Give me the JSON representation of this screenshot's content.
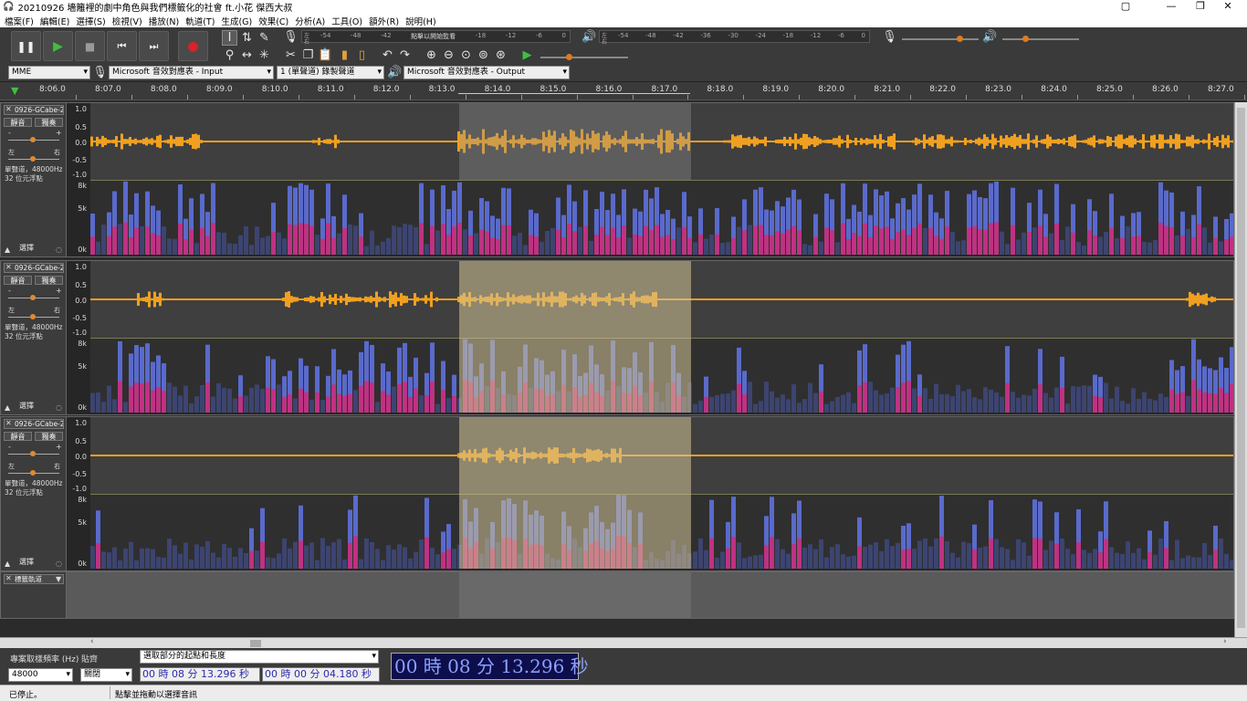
{
  "window": {
    "title": "20210926 墻籬裡的劇中角色與我們標籤化的社會 ft.小花 傑西大叔",
    "controls": [
      "▢",
      "—",
      "❐",
      "✕"
    ]
  },
  "menu": [
    "檔案(F)",
    "編輯(E)",
    "選擇(S)",
    "檢視(V)",
    "播放(N)",
    "軌道(T)",
    "生成(G)",
    "效果(C)",
    "分析(A)",
    "工具(O)",
    "額外(R)",
    "說明(H)"
  ],
  "transport": {
    "pause": "❚❚",
    "play": "▶",
    "stop": "■",
    "skip_start": "⏮",
    "skip_end": "⏭",
    "record": "●"
  },
  "meters": {
    "record_ticks": [
      "-54",
      "-48",
      "-42",
      "點擊以開始監看",
      "-18",
      "-12",
      "-6",
      "0"
    ],
    "play_ticks": [
      "-54",
      "-48",
      "-42",
      "-36",
      "-30",
      "-24",
      "-18",
      "-12",
      "-6",
      "0"
    ],
    "lr": [
      "左",
      "右"
    ]
  },
  "device_bar": {
    "host": "MME",
    "input": "Microsoft 音效對應表 - Input",
    "channels": "1 (單聲道) 錄製聲道",
    "output": "Microsoft 音效對應表 - Output"
  },
  "ruler": {
    "ticks": [
      "8:06.0",
      "8:07.0",
      "8:08.0",
      "8:09.0",
      "8:10.0",
      "8:11.0",
      "8:12.0",
      "8:13.0",
      "8:14.0",
      "8:15.0",
      "8:16.0",
      "8:17.0",
      "8:18.0",
      "8:19.0",
      "8:20.0",
      "8:21.0",
      "8:22.0",
      "8:23.0",
      "8:24.0",
      "8:25.0",
      "8:26.0",
      "8:27.0"
    ]
  },
  "tracks": [
    {
      "name": "0926-GCabe-2",
      "mute": "靜音",
      "solo": "獨奏",
      "info1": "單聲道，48000Hz",
      "info2": "32 位元浮點",
      "select": "選擇",
      "left": "左",
      "right": "右",
      "minus": "-",
      "plus": "+"
    },
    {
      "name": "0926-GCabe-2",
      "mute": "靜音",
      "solo": "獨奏",
      "info1": "單聲道，48000Hz",
      "info2": "32 位元浮點",
      "select": "選擇",
      "left": "左",
      "right": "右",
      "minus": "-",
      "plus": "+"
    },
    {
      "name": "0926-GCabe-2",
      "mute": "靜音",
      "solo": "獨奏",
      "info1": "單聲道，48000Hz",
      "info2": "32 位元浮點",
      "select": "選擇",
      "left": "左",
      "right": "右",
      "minus": "-",
      "plus": "+"
    }
  ],
  "label_track": {
    "name": "標籤軌道",
    "close": "✕",
    "menu": "▼"
  },
  "y_wave": [
    "1.0",
    "0.5",
    "0.0",
    "-0.5",
    "-1.0"
  ],
  "y_spec": [
    "8k",
    "5k",
    "0k"
  ],
  "selection_toolbar": {
    "rate_label": "專案取樣頻率 (Hz)",
    "rate_value": "48000",
    "snap_label": "貼齊",
    "snap_value": "關閉",
    "mode": "選取部分的起點和長度",
    "start": "00 時 08 分 13.296 秒",
    "length": "00 時 00 分 04.180 秒",
    "big_time": "00 時 08 分 13.296 秒"
  },
  "status": {
    "state": "已停止。",
    "hint": "點擊並拖動以選擇音訊"
  },
  "colors": {
    "accent": "#e08a2f",
    "wave": "#f0a020",
    "spec_hi": "#e0206a",
    "spec_lo": "#5a6acc",
    "selection": "#c8b890"
  }
}
